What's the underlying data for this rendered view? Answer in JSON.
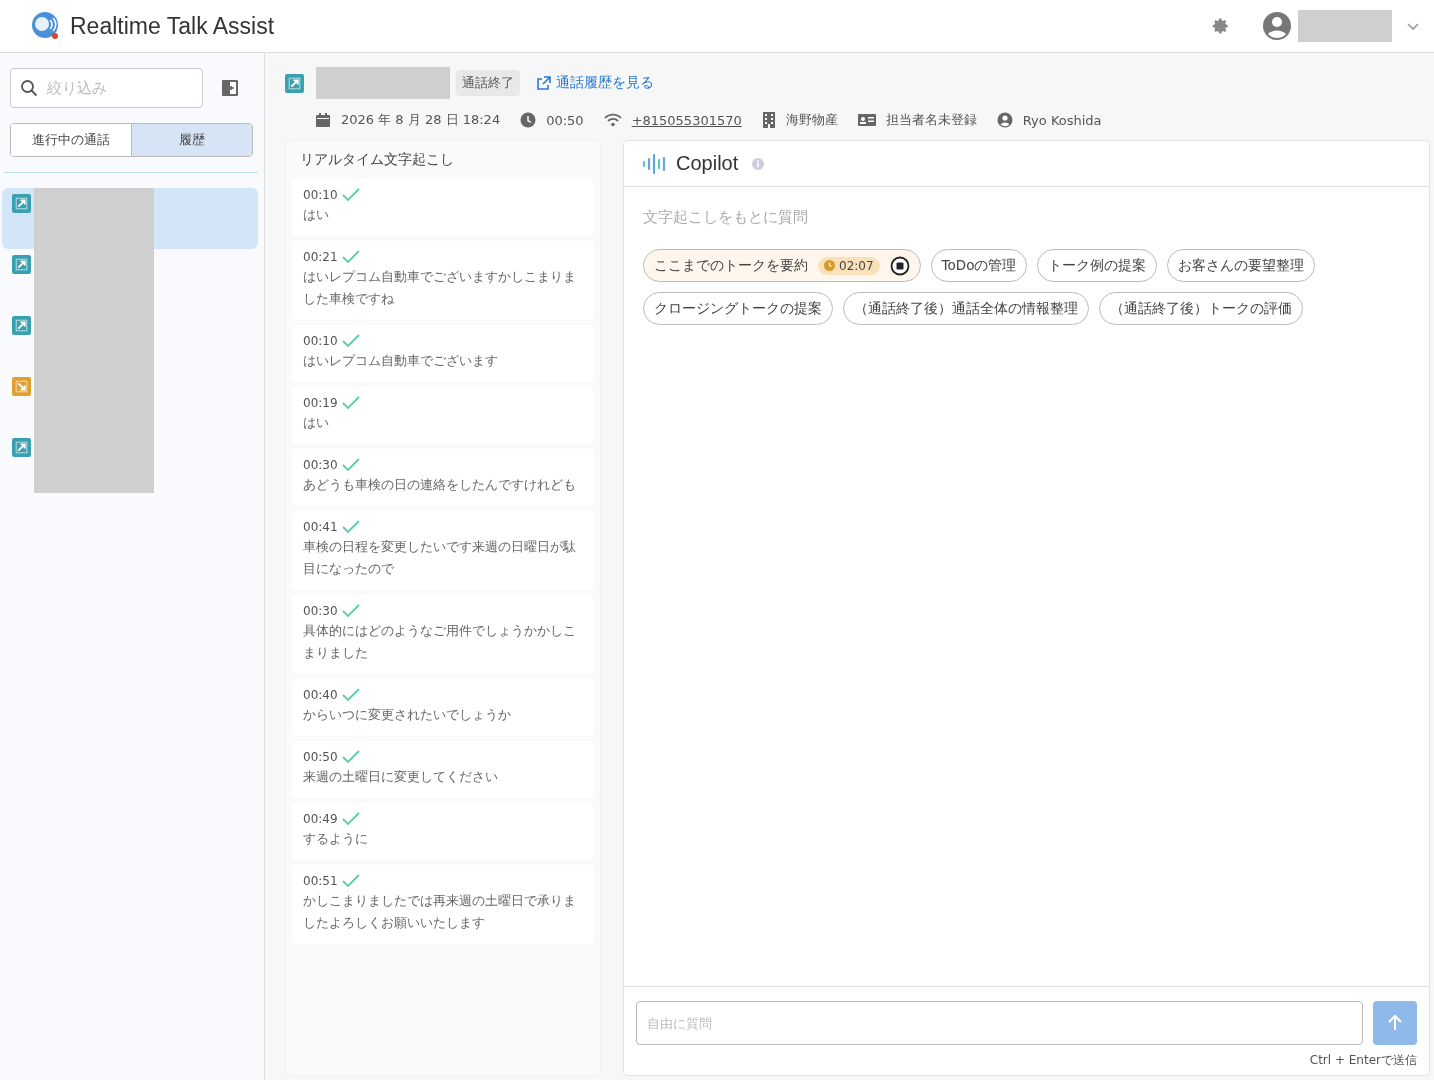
{
  "app": {
    "title": "Realtime Talk Assist"
  },
  "sidebar": {
    "search": {
      "placeholder": "絞り込み"
    },
    "tabs": [
      {
        "label": "進行中の通話",
        "selected": false
      },
      {
        "label": "履歴",
        "selected": true
      }
    ],
    "items": [
      {
        "kind": "outgoing",
        "selected": true
      },
      {
        "kind": "outgoing",
        "selected": false
      },
      {
        "kind": "outgoing",
        "selected": false
      },
      {
        "kind": "incoming",
        "selected": false
      },
      {
        "kind": "outgoing",
        "selected": false
      }
    ]
  },
  "call": {
    "kind": "outgoing",
    "status": "通話終了",
    "history_link": "通話履歴を見る",
    "meta": [
      {
        "kind": "date",
        "text": "2026 年 8 月 28 日 18:24"
      },
      {
        "kind": "duration",
        "text": "00:50"
      },
      {
        "kind": "phone",
        "text": "+815055301570"
      },
      {
        "kind": "company",
        "text": "海野物産"
      },
      {
        "kind": "contact",
        "text": "担当者名未登録"
      },
      {
        "kind": "agent",
        "text": "Ryo Koshida"
      }
    ]
  },
  "transcript": {
    "title": "リアルタイム文字起こし",
    "entries": [
      {
        "time": "00:10",
        "confirmed": true,
        "text": "はい"
      },
      {
        "time": "00:21",
        "confirmed": true,
        "text": "はいレプコム自動車でございますかしこまりました車検ですね"
      },
      {
        "time": "00:10",
        "confirmed": true,
        "text": "はいレプコム自動車でございます"
      },
      {
        "time": "00:19",
        "confirmed": true,
        "text": "はい"
      },
      {
        "time": "00:30",
        "confirmed": true,
        "text": "あどうも車検の日の連絡をしたんですけれども"
      },
      {
        "time": "00:41",
        "confirmed": true,
        "text": "車検の日程を変更したいです来週の日曜日が駄目になったので"
      },
      {
        "time": "00:30",
        "confirmed": true,
        "text": "具体的にはどのようなご用件でしょうかかしこまりました"
      },
      {
        "time": "00:40",
        "confirmed": true,
        "text": "からいつに変更されたいでしょうか"
      },
      {
        "time": "00:50",
        "confirmed": true,
        "text": "来週の土曜日に変更してください"
      },
      {
        "time": "00:49",
        "confirmed": true,
        "text": "するように"
      },
      {
        "time": "00:51",
        "confirmed": true,
        "text": "かしこまりましたでは再来週の土曜日で承りましたよろしくお願いいたします"
      }
    ]
  },
  "copilot": {
    "title": "Copilot",
    "prompt": "文字起こしをもとに質問",
    "chips": [
      {
        "label": "ここまでのトークを要約",
        "active": true,
        "timer": "02:07"
      },
      {
        "label": "ToDoの管理",
        "active": false
      },
      {
        "label": "トーク例の提案",
        "active": false
      },
      {
        "label": "お客さんの要望整理",
        "active": false
      },
      {
        "label": "クロージングトークの提案",
        "active": false
      },
      {
        "label": "（通話終了後）通話全体の情報整理",
        "active": false
      },
      {
        "label": "（通話終了後）トークの評価",
        "active": false
      }
    ],
    "input": {
      "placeholder": "自由に質問"
    },
    "hint": "Ctrl + Enterで送信"
  }
}
